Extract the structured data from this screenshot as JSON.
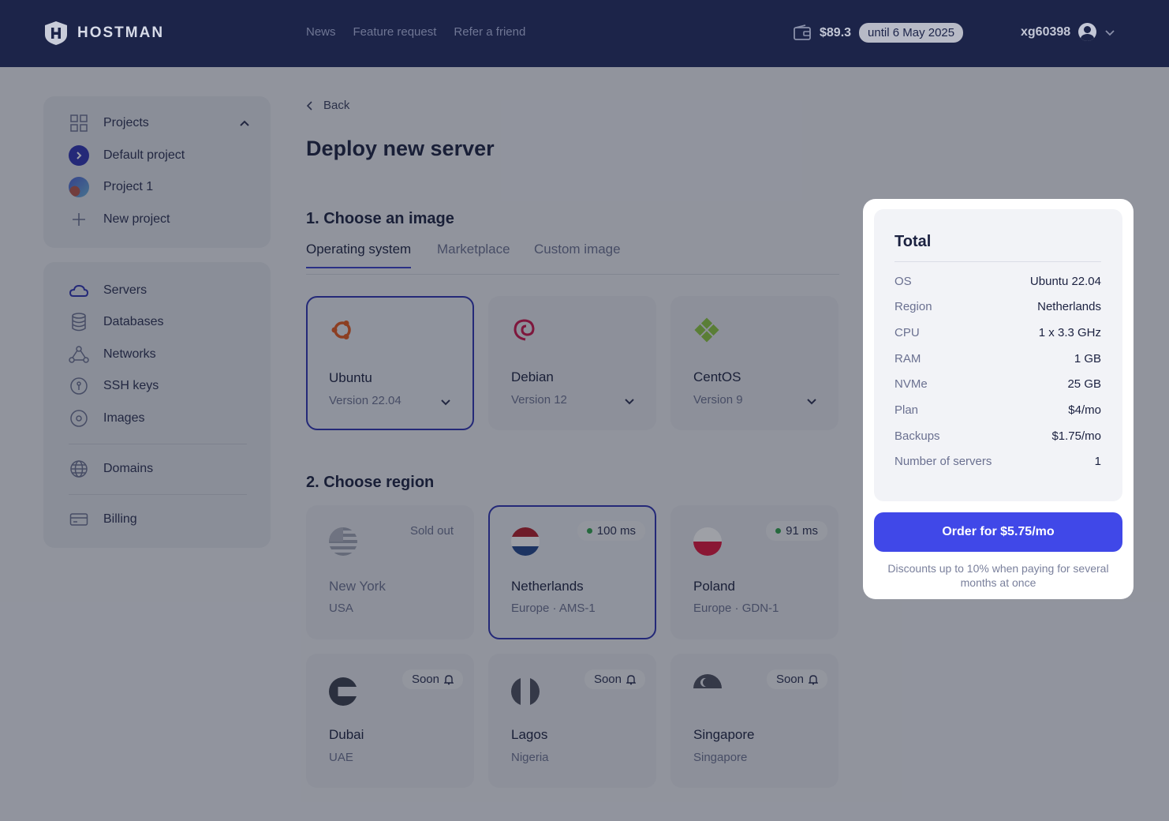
{
  "header": {
    "logo_text": "HOSTMAN",
    "nav": [
      "News",
      "Feature request",
      "Refer a friend"
    ],
    "balance": "$89.3",
    "until": "until 6 May 2025",
    "username": "xg60398"
  },
  "sidebar": {
    "projects_label": "Projects",
    "projects": [
      "Default project",
      "Project 1",
      "New project"
    ],
    "items": [
      "Servers",
      "Databases",
      "Networks",
      "SSH keys",
      "Images",
      "Domains",
      "Billing"
    ]
  },
  "main": {
    "back": "Back",
    "title": "Deploy new server",
    "section1": "1. Choose an image",
    "tabs": [
      "Operating system",
      "Marketplace",
      "Custom image"
    ],
    "os": [
      {
        "name": "Ubuntu",
        "version": "Version 22.04"
      },
      {
        "name": "Debian",
        "version": "Version 12"
      },
      {
        "name": "CentOS",
        "version": "Version 9"
      }
    ],
    "section2": "2. Choose region",
    "regions": [
      {
        "name": "New York",
        "sub": "USA",
        "badge": "Sold out"
      },
      {
        "name": "Netherlands",
        "sub": "Europe · AMS-1",
        "badge": "100 ms"
      },
      {
        "name": "Poland",
        "sub": "Europe · GDN-1",
        "badge": "91 ms"
      },
      {
        "name": "Dubai",
        "sub": "UAE",
        "badge": "Soon"
      },
      {
        "name": "Lagos",
        "sub": "Nigeria",
        "badge": "Soon"
      },
      {
        "name": "Singapore",
        "sub": "Singapore",
        "badge": "Soon"
      }
    ]
  },
  "total": {
    "title": "Total",
    "rows": [
      {
        "k": "OS",
        "v": "Ubuntu 22.04"
      },
      {
        "k": "Region",
        "v": "Netherlands"
      },
      {
        "k": "CPU",
        "v": "1 x 3.3 GHz"
      },
      {
        "k": "RAM",
        "v": "1 GB"
      },
      {
        "k": "NVMe",
        "v": "25 GB"
      },
      {
        "k": "Plan",
        "v": "$4/mo"
      },
      {
        "k": "Backups",
        "v": "$1.75/mo"
      },
      {
        "k": "Number of servers",
        "v": "1"
      }
    ],
    "order_label": "Order for $5.75/mo",
    "discount": "Discounts up to 10% when paying for several months at once"
  }
}
